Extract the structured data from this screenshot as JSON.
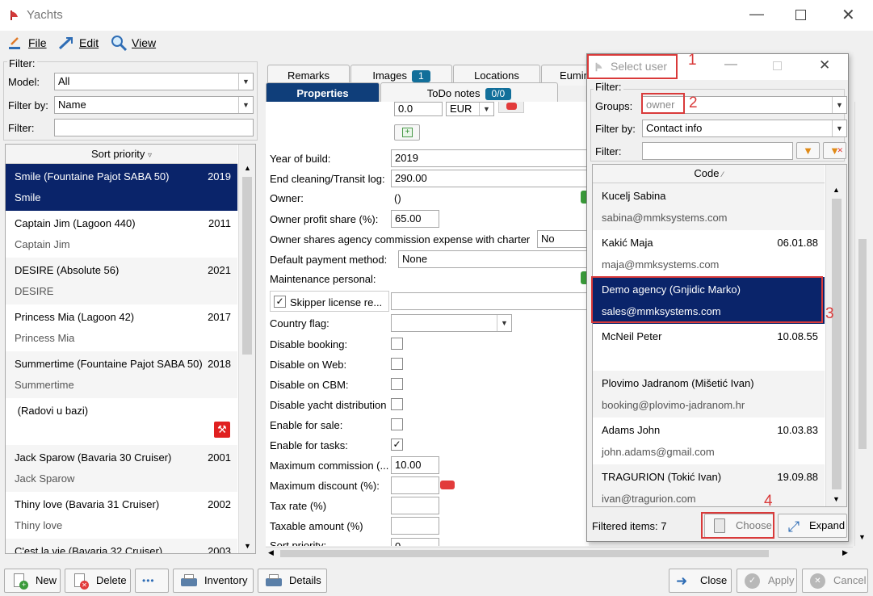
{
  "window": {
    "title": "Yachts"
  },
  "menu": {
    "file": "File",
    "edit": "Edit",
    "view": "View"
  },
  "filter": {
    "legend": "Filter:",
    "model_label": "Model:",
    "model_value": "All",
    "filterby_label": "Filter by:",
    "filterby_value": "Name",
    "filter_label": "Filter:",
    "filter_value": ""
  },
  "list": {
    "header": "Sort priority",
    "header_sort_icon": "sort-down-icon",
    "items": [
      {
        "name": "Smile (Fountaine Pajot SABA 50)",
        "year": "2019",
        "short": "Smile"
      },
      {
        "name": "Captain Jim (Lagoon 440)",
        "year": "2011",
        "short": "Captain Jim"
      },
      {
        "name": "DESIRE (Absolute 56)",
        "year": "2021",
        "short": "DESIRE"
      },
      {
        "name": "Princess Mia (Lagoon 42)",
        "year": "2017",
        "short": "Princess Mia"
      },
      {
        "name": "Summertime (Fountaine Pajot SABA 50)",
        "year": "2018",
        "short": "Summertime"
      },
      {
        "name": " (Radovi u bazi)",
        "year": "",
        "short": ""
      },
      {
        "name": "Jack Sparow (Bavaria 30 Cruiser)",
        "year": "2001",
        "short": "Jack Sparow"
      },
      {
        "name": "Thiny love (Bavaria 31 Cruiser)",
        "year": "2002",
        "short": "Thiny love"
      },
      {
        "name": "C'est la vie (Bavaria 32 Cruiser)",
        "year": "2003",
        "short": ""
      }
    ]
  },
  "tabs": {
    "remarks": "Remarks",
    "images": "Images",
    "images_count": "1",
    "locations": "Locations",
    "euminder": "Eumin",
    "properties": "Properties",
    "todo": "ToDo notes",
    "todo_count": "0/0"
  },
  "form": {
    "price_value": "0.0",
    "currency_value": "EUR",
    "year_label": "Year of build:",
    "year_value": "2019",
    "end_cleaning_label": "End cleaning/Transit log:",
    "end_cleaning_value": "290.00",
    "owner_label": "Owner:",
    "owner_value": "()",
    "owner_share_label": "Owner profit share (%):",
    "owner_share_value": "65.00",
    "owner_agency_label": "Owner shares agency commission expense with charter",
    "owner_agency_value": "No",
    "payment_label": "Default payment method:",
    "payment_value": "None",
    "maintenance_label": "Maintenance personal:",
    "skipper_label": "Skipper license re...",
    "country_label": "Country flag:",
    "disable_booking_label": "Disable booking:",
    "disable_web_label": "Disable on Web:",
    "disable_cbm_label": "Disable on CBM:",
    "disable_distribution_label": "Disable yacht distribution",
    "enable_sale_label": "Enable for sale:",
    "enable_tasks_label": "Enable for tasks:",
    "max_commission_label": "Maximum commission (...",
    "max_commission_value": "10.00",
    "max_discount_label": "Maximum discount (%):",
    "tax_rate_label": "Tax rate (%)",
    "taxable_label": "Taxable amount (%)",
    "sort_priority_label": "Sort priority:",
    "sort_priority_value": "0"
  },
  "dialog": {
    "title": "Select user",
    "filter_legend": "Filter:",
    "groups_label": "Groups:",
    "groups_value": "owner",
    "filterby_label": "Filter by:",
    "filterby_value": "Contact info",
    "filter_label": "Filter:",
    "filter_value": "",
    "header": "Code",
    "users": [
      {
        "name": "Kucelj Sabina",
        "email": "sabina@mmksystems.com",
        "date": ""
      },
      {
        "name": "Kakić Maja",
        "email": "maja@mmksystems.com",
        "date": "06.01.88"
      },
      {
        "name": "Demo agency (Gnjidic Marko)",
        "email": "sales@mmksystems.com",
        "date": ""
      },
      {
        "name": "McNeil Peter",
        "email": "",
        "date": "10.08.55"
      },
      {
        "name": "Plovimo Jadranom (Mišetić Ivan)",
        "email": "booking@plovimo-jadranom.hr",
        "date": ""
      },
      {
        "name": "Adams John",
        "email": "john.adams@gmail.com",
        "date": "10.03.83"
      },
      {
        "name": "TRAGURION (Tokić Ivan)",
        "email": "ivan@tragurion.com",
        "date": "19.09.88"
      }
    ],
    "filtered_label": "Filtered items: 7",
    "choose_label": "Choose",
    "expand_label": "Expand"
  },
  "annotations": {
    "n1": "1",
    "n2": "2",
    "n3": "3",
    "n4": "4"
  },
  "buttons": {
    "new": "New",
    "delete": "Delete",
    "more": "•••",
    "inventory": "Inventory",
    "details": "Details",
    "close": "Close",
    "apply": "Apply",
    "cancel": "Cancel"
  },
  "colors": {
    "selection": "#0a246a",
    "tab_active": "#0f3e7a",
    "badge": "#126f9a",
    "annotation": "#d93a3a"
  }
}
